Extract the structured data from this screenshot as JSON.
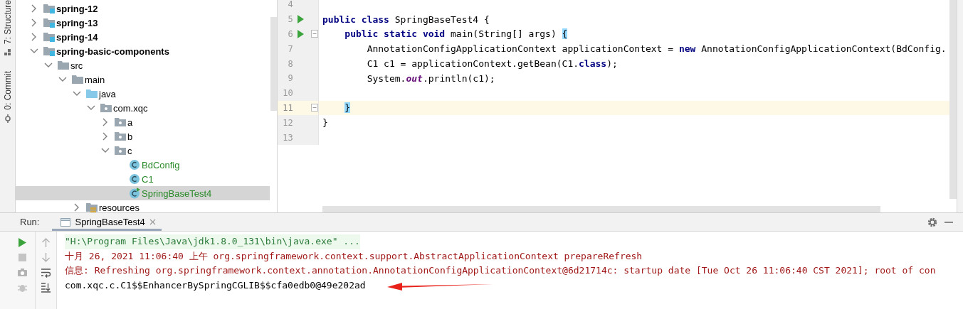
{
  "tool_strip": [
    {
      "label": "7: Structure",
      "kind": "structure"
    },
    {
      "label": "0: Commit",
      "kind": "commit"
    }
  ],
  "project_tree": [
    {
      "label": "spring-12",
      "kind": "module",
      "expanded": false,
      "selected": false
    },
    {
      "label": "spring-13",
      "kind": "module",
      "expanded": false,
      "selected": false
    },
    {
      "label": "spring-14",
      "kind": "module",
      "expanded": false,
      "selected": false
    },
    {
      "label": "spring-basic-components",
      "kind": "module",
      "expanded": true,
      "selected": false,
      "children": [
        {
          "label": "src",
          "kind": "folder",
          "expanded": true,
          "selected": false,
          "children": [
            {
              "label": "main",
              "kind": "folder",
              "expanded": true,
              "selected": false,
              "children": [
                {
                  "label": "java",
                  "kind": "source-root",
                  "expanded": true,
                  "selected": false,
                  "children": [
                    {
                      "label": "com.xqc",
                      "kind": "package",
                      "expanded": true,
                      "selected": false,
                      "children": [
                        {
                          "label": "a",
                          "kind": "package",
                          "expanded": false,
                          "selected": false
                        },
                        {
                          "label": "b",
                          "kind": "package",
                          "expanded": false,
                          "selected": false
                        },
                        {
                          "label": "c",
                          "kind": "package",
                          "expanded": true,
                          "selected": false,
                          "children": [
                            {
                              "label": "BdConfig",
                              "kind": "class",
                              "vcs_added": true,
                              "selected": false
                            },
                            {
                              "label": "C1",
                              "kind": "class",
                              "vcs_added": true,
                              "selected": false
                            },
                            {
                              "label": "SpringBaseTest4",
                              "kind": "runnable-class",
                              "vcs_added": true,
                              "selected": true
                            }
                          ]
                        }
                      ]
                    }
                  ]
                },
                {
                  "label": "resources",
                  "kind": "resources-root",
                  "expanded": false,
                  "selected": false
                }
              ]
            }
          ]
        }
      ]
    }
  ],
  "editor": {
    "lines": [
      {
        "number": "4",
        "current": false
      },
      {
        "number": "5",
        "current": false,
        "run_marker": true,
        "tokens": [
          {
            "text": "public class",
            "kind": "keyword"
          },
          {
            "text": " SpringBaseTest4 {",
            "kind": "plain"
          }
        ]
      },
      {
        "number": "6",
        "current": false,
        "run_marker": true,
        "fold_marker": true,
        "tokens": [
          {
            "text": "    public static void",
            "kind": "keyword"
          },
          {
            "text": " main(String[] args) ",
            "kind": "plain"
          },
          {
            "text": "{",
            "kind": "brace-match"
          }
        ]
      },
      {
        "number": "7",
        "current": false,
        "tokens": [
          {
            "text": "        AnnotationConfigApplicationContext applicationContext = ",
            "kind": "plain"
          },
          {
            "text": "new",
            "kind": "keyword"
          },
          {
            "text": " AnnotationConfigApplicationContext(BdConfig.",
            "kind": "plain"
          }
        ]
      },
      {
        "number": "8",
        "current": false,
        "tokens": [
          {
            "text": "        C1 c1 = applicationContext.getBean(C1.",
            "kind": "plain"
          },
          {
            "text": "class",
            "kind": "keyword"
          },
          {
            "text": ");",
            "kind": "plain"
          }
        ]
      },
      {
        "number": "9",
        "current": false,
        "tokens": [
          {
            "text": "        System.",
            "kind": "plain"
          },
          {
            "text": "out",
            "kind": "static-field"
          },
          {
            "text": ".println(c1);",
            "kind": "plain"
          }
        ]
      },
      {
        "number": "10",
        "current": false
      },
      {
        "number": "11",
        "current": true,
        "fold_marker": true,
        "tokens": [
          {
            "text": "    }",
            "kind": "brace-match"
          }
        ]
      },
      {
        "number": "12",
        "current": false,
        "tokens": [
          {
            "text": "}",
            "kind": "plain"
          }
        ]
      },
      {
        "number": "13",
        "current": false
      }
    ]
  },
  "run_panel": {
    "label": "Run:",
    "tabs": [
      {
        "label": "SpringBaseTest4",
        "selected": true
      }
    ],
    "console": [
      {
        "text": "\"H:\\Program Files\\Java\\jdk1.8.0_131\\bin\\java.exe\" ...",
        "kind": "command"
      },
      {
        "text": "十月 26, 2021 11:06:40 上午 org.springframework.context.support.AbstractApplicationContext prepareRefresh",
        "kind": "stderr"
      },
      {
        "text": "信息: Refreshing org.springframework.context.annotation.AnnotationConfigApplicationContext@6d21714c: startup date [Tue Oct 26 11:06:40 CST 2021]; root of con",
        "kind": "stderr"
      },
      {
        "text": "com.xqc.c.C1$$EnhancerBySpringCGLIB$$cfa0edb0@49e202ad",
        "kind": "stdout"
      }
    ]
  }
}
